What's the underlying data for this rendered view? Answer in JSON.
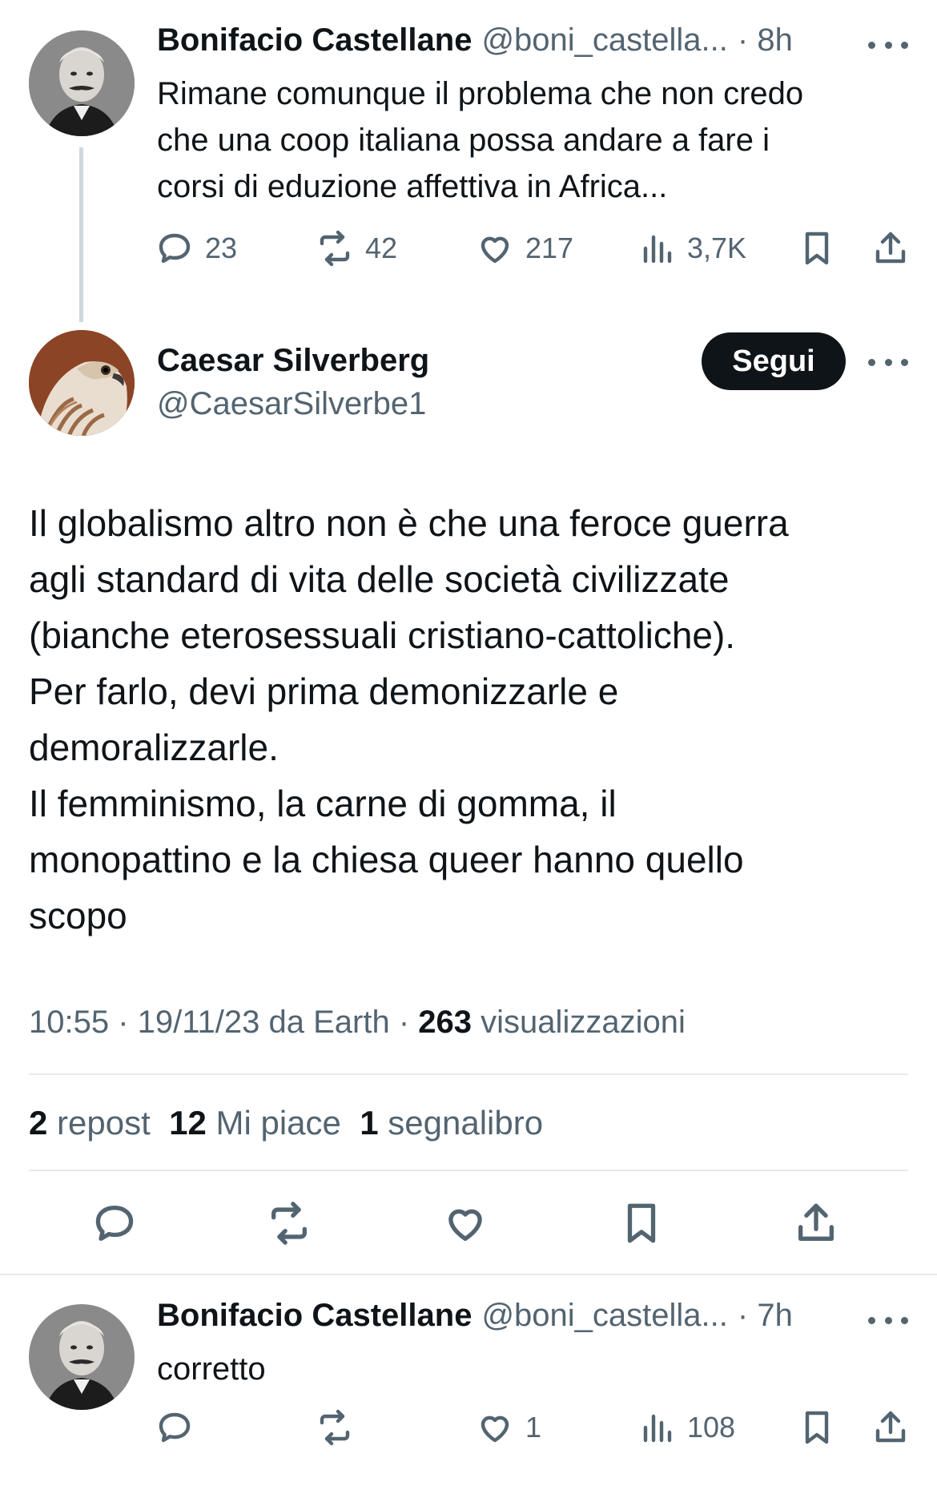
{
  "thread": [
    {
      "author_name": "Bonifacio Castellane",
      "author_handle": "@boni_castella...",
      "time": "· 8h",
      "text_lines": [
        "Rimane comunque il problema che non credo",
        "che una coop italiana possa andare a fare i",
        "corsi di eduzione affettiva in Africa..."
      ],
      "replies": "23",
      "reposts": "42",
      "likes": "217",
      "views": "3,7K"
    }
  ],
  "main_tweet": {
    "author_name": "Caesar Silverberg",
    "author_handle": "@CaesarSilverbe1",
    "follow_label": "Segui",
    "text_lines": [
      "Il globalismo altro non è che una feroce guerra",
      "agli standard di vita delle società civilizzate",
      "(bianche eterosessuali cristiano-cattoliche).",
      "Per farlo, devi prima demonizzarle e",
      "demoralizzarle.",
      "Il femminismo, la carne di gomma, il",
      "monopattino e la chiesa queer hanno quello",
      "scopo"
    ],
    "meta": {
      "time": "10:55",
      "date_source": "· 19/11/23 da Earth ·",
      "views_count": "263",
      "views_label": "visualizzazioni"
    },
    "stats": {
      "reposts_count": "2",
      "reposts_label": "repost",
      "likes_count": "12",
      "likes_label": "Mi piace",
      "bookmarks_count": "1",
      "bookmarks_label": "segnalibro"
    }
  },
  "reply": {
    "author_name": "Bonifacio Castellane",
    "author_handle": "@boni_castella...",
    "time": "· 7h",
    "text": "corretto",
    "replies": "",
    "reposts": "",
    "likes": "1",
    "views": "108"
  },
  "colors": {
    "text": "#0f1419",
    "secondary": "#536471",
    "divider": "#e6e9eb",
    "thread_line": "#cfd9de",
    "button_bg": "#0f1419"
  }
}
